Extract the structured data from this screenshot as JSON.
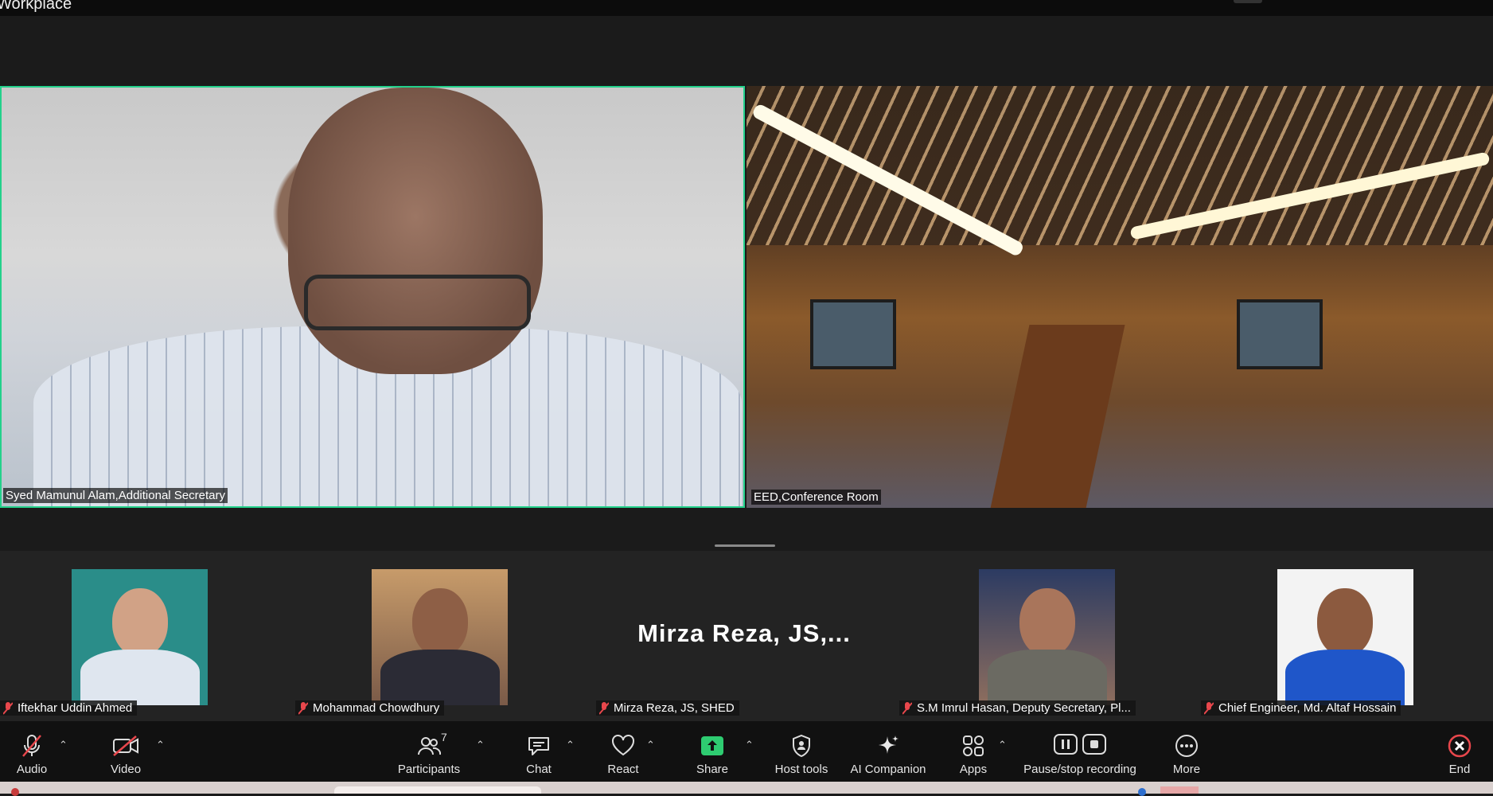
{
  "window": {
    "title": "Workplace"
  },
  "main_videos": [
    {
      "name": "Syed Mamunul Alam,Additional Secretary",
      "active_speaker": true
    },
    {
      "name": "EED,Conference Room",
      "active_speaker": false
    }
  ],
  "participants_strip": [
    {
      "name": "Iftekhar Uddin Ahmed",
      "muted": true,
      "has_photo": true
    },
    {
      "name": "Mohammad Chowdhury",
      "muted": true,
      "has_photo": true
    },
    {
      "name": "Mirza Reza, JS, SHED",
      "display_name": "Mirza Reza, JS,...",
      "muted": true,
      "has_photo": false
    },
    {
      "name": "S.M Imrul Hasan, Deputy Secretary, Pl...",
      "muted": true,
      "has_photo": true
    },
    {
      "name": "Chief Engineer, Md. Altaf Hossain",
      "muted": true,
      "has_photo": true
    }
  ],
  "toolbar": {
    "audio": "Audio",
    "video": "Video",
    "participants": "Participants",
    "participants_count": "7",
    "chat": "Chat",
    "react": "React",
    "share": "Share",
    "host_tools": "Host tools",
    "ai_companion": "AI Companion",
    "apps": "Apps",
    "recording": "Pause/stop recording",
    "more": "More",
    "end": "End"
  },
  "colors": {
    "active_border": "#23d18b",
    "share_green": "#2ecc71",
    "end_red": "#e8474c"
  },
  "icons": [
    "mic-off-icon",
    "video-off-icon",
    "participants-icon",
    "chat-icon",
    "heart-icon",
    "share-arrow-icon",
    "shield-icon",
    "sparkle-icon",
    "apps-icon",
    "pause-icon",
    "stop-icon",
    "ellipsis-icon",
    "close-circle-icon"
  ]
}
